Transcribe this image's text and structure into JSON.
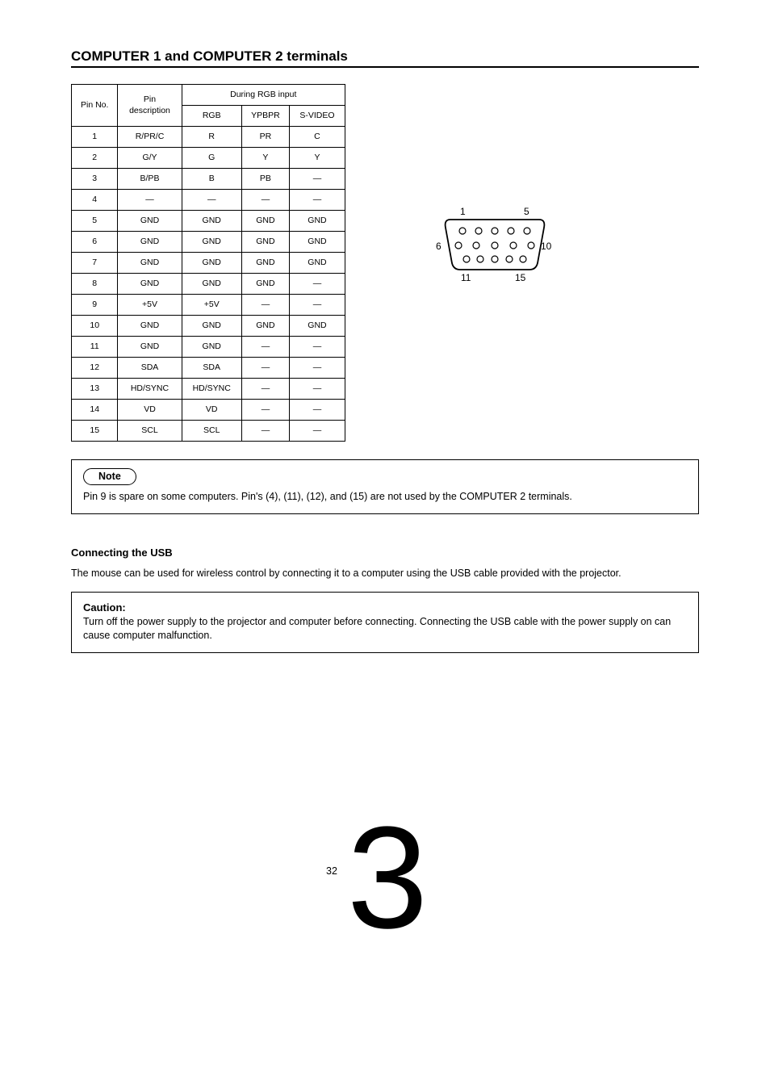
{
  "section_title": "COMPUTER 1 and COMPUTER 2 terminals",
  "table": {
    "head": {
      "pin_no": "Pin No.",
      "pin_desc": "Pin\ndescription",
      "during_input": "During RGB input",
      "rgb": "RGB",
      "ypbpr": "YPBPR",
      "svideo": "S-VIDEO"
    },
    "rows": [
      [
        "1",
        "R/PR/C",
        "R",
        "PR",
        "C"
      ],
      [
        "2",
        "G/Y",
        "G",
        "Y",
        "Y"
      ],
      [
        "3",
        "B/PB",
        "B",
        "PB",
        "—"
      ],
      [
        "4",
        "—",
        "—",
        "—",
        "—"
      ],
      [
        "5",
        "GND",
        "GND",
        "GND",
        "GND"
      ],
      [
        "6",
        "GND",
        "GND",
        "GND",
        "GND"
      ],
      [
        "7",
        "GND",
        "GND",
        "GND",
        "GND"
      ],
      [
        "8",
        "GND",
        "GND",
        "GND",
        "—"
      ],
      [
        "9",
        "+5V",
        "+5V",
        "—",
        "—"
      ],
      [
        "10",
        "GND",
        "GND",
        "GND",
        "GND"
      ],
      [
        "11",
        "GND",
        "GND",
        "—",
        "—"
      ],
      [
        "12",
        "SDA",
        "SDA",
        "—",
        "—"
      ],
      [
        "13",
        "HD/SYNC",
        "HD/SYNC",
        "—",
        "—"
      ],
      [
        "14",
        "VD",
        "VD",
        "—",
        "—"
      ],
      [
        "15",
        "SCL",
        "SCL",
        "—",
        "—"
      ]
    ]
  },
  "diagram": {
    "p1": "1",
    "p5": "5",
    "p6": "6",
    "p10": "10",
    "p11": "11",
    "p15": "15"
  },
  "note": {
    "label": "Note",
    "body": "Pin 9 is spare on some computers. Pin's (4), (11), (12), and (15) are not used by the COMPUTER 2 terminals."
  },
  "sub_title": "Connecting the USB",
  "body_text": "The mouse can be used for wireless control by connecting it to a computer using the USB cable provided with the projector.",
  "caution": {
    "label": "Caution:",
    "body": "Turn off the power supply to the projector and computer before connecting. Connecting the USB cable with the power supply on can cause computer malfunction."
  },
  "footer": {
    "page": "32",
    "big_num": "3"
  }
}
